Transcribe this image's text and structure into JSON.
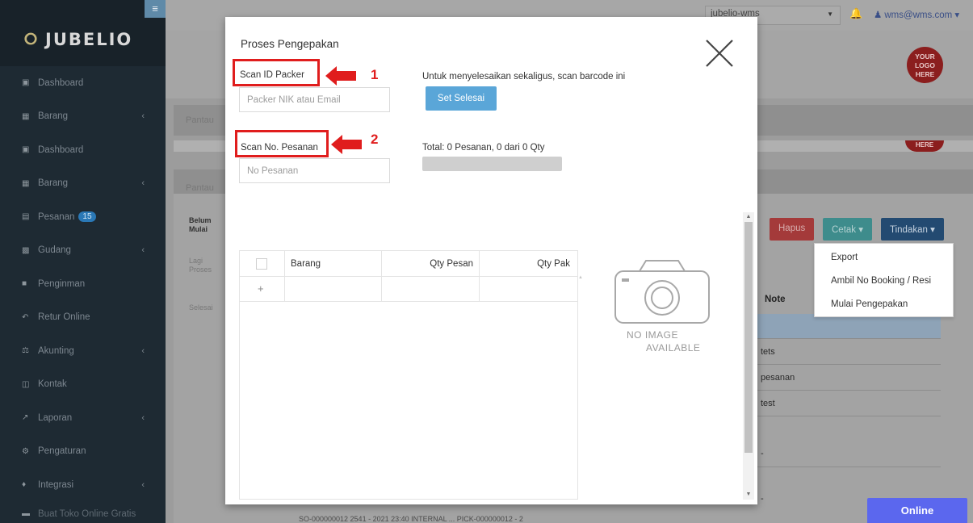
{
  "app": {
    "brand": "JUBELIO",
    "hamburger_icon": "menu-icon"
  },
  "sidebar": {
    "items": [
      {
        "label": "Dashboard",
        "icon": "chart-icon",
        "chevron": false
      },
      {
        "label": "Barang",
        "icon": "cubes-icon",
        "chevron": true
      },
      {
        "label": "Dashboard",
        "icon": "chart-icon",
        "chevron": false
      },
      {
        "label": "Barang",
        "icon": "cubes-icon",
        "chevron": true
      },
      {
        "label": "Pesanan",
        "icon": "cart-icon",
        "chevron": false,
        "badge": "15"
      },
      {
        "label": "Gudang",
        "icon": "building-icon",
        "chevron": true
      },
      {
        "label": "Penginman",
        "icon": "truck-icon",
        "chevron": false
      },
      {
        "label": "Retur Online",
        "icon": "reply-icon",
        "chevron": false
      },
      {
        "label": "Akunting",
        "icon": "scale-icon",
        "chevron": true
      },
      {
        "label": "Kontak",
        "icon": "contact-card-icon",
        "chevron": false
      },
      {
        "label": "Laporan",
        "icon": "line-chart-icon",
        "chevron": true
      },
      {
        "label": "Pengaturan",
        "icon": "cogs-icon",
        "chevron": false
      },
      {
        "label": "Integrasi",
        "icon": "puzzle-icon",
        "chevron": true
      },
      {
        "label": "Buat Toko Online Gratis",
        "icon": "store-icon",
        "chevron": false
      }
    ]
  },
  "topbar": {
    "warehouse": "jubelio-wms",
    "user": "wms@wms.com"
  },
  "background_page": {
    "logo_text": [
      "YOUR",
      "LOGO",
      "HERE"
    ],
    "logo_partial": "HERE",
    "tab_pant_1": "Pantau",
    "tab_pant_2": "Pantau",
    "tab_belum": "Belum Mulai",
    "tab_lagi": "Lagi Proses",
    "tab_selesai": "Selesai",
    "buttons": {
      "hapus": "Hapus",
      "cetak": "Cetak",
      "tindakan": "Tindakan"
    },
    "dropdown_items": [
      "Export",
      "Ambil No Booking / Resi",
      "Mulai Pengepakan"
    ],
    "note_header": "Note",
    "notes": [
      "tets",
      "pesanan",
      "test",
      "-",
      "-"
    ],
    "bottom_row": "SO-000000012   2541 - 2021 23:40   INTERNAL   ...   PICK-000000012 - 2"
  },
  "modal": {
    "title": "Proses Pengepakan",
    "scan_packer_label": "Scan ID Packer",
    "packer_placeholder": "Packer NIK atau Email",
    "finish_hint": "Untuk menyelesaikan sekaligus, scan barcode ini",
    "finish_button": "Set Selesai",
    "scan_order_label": "Scan No. Pesanan",
    "order_placeholder": "No Pesanan",
    "total_text": "Total: 0 Pesanan, 0 dari 0 Qty",
    "progress_fraction": 0,
    "annotation_1": "1",
    "annotation_2": "2",
    "table": {
      "columns": [
        "Barang",
        "Qty Pesan",
        "Qty Pak"
      ]
    },
    "no_image": "NO IMAGE",
    "available": "AVAILABLE"
  },
  "online_label": "Online",
  "colors": {
    "annotation_red": "#e01d1d",
    "primary_button": "#5aa6d8",
    "online_chat": "#5b67ee"
  }
}
